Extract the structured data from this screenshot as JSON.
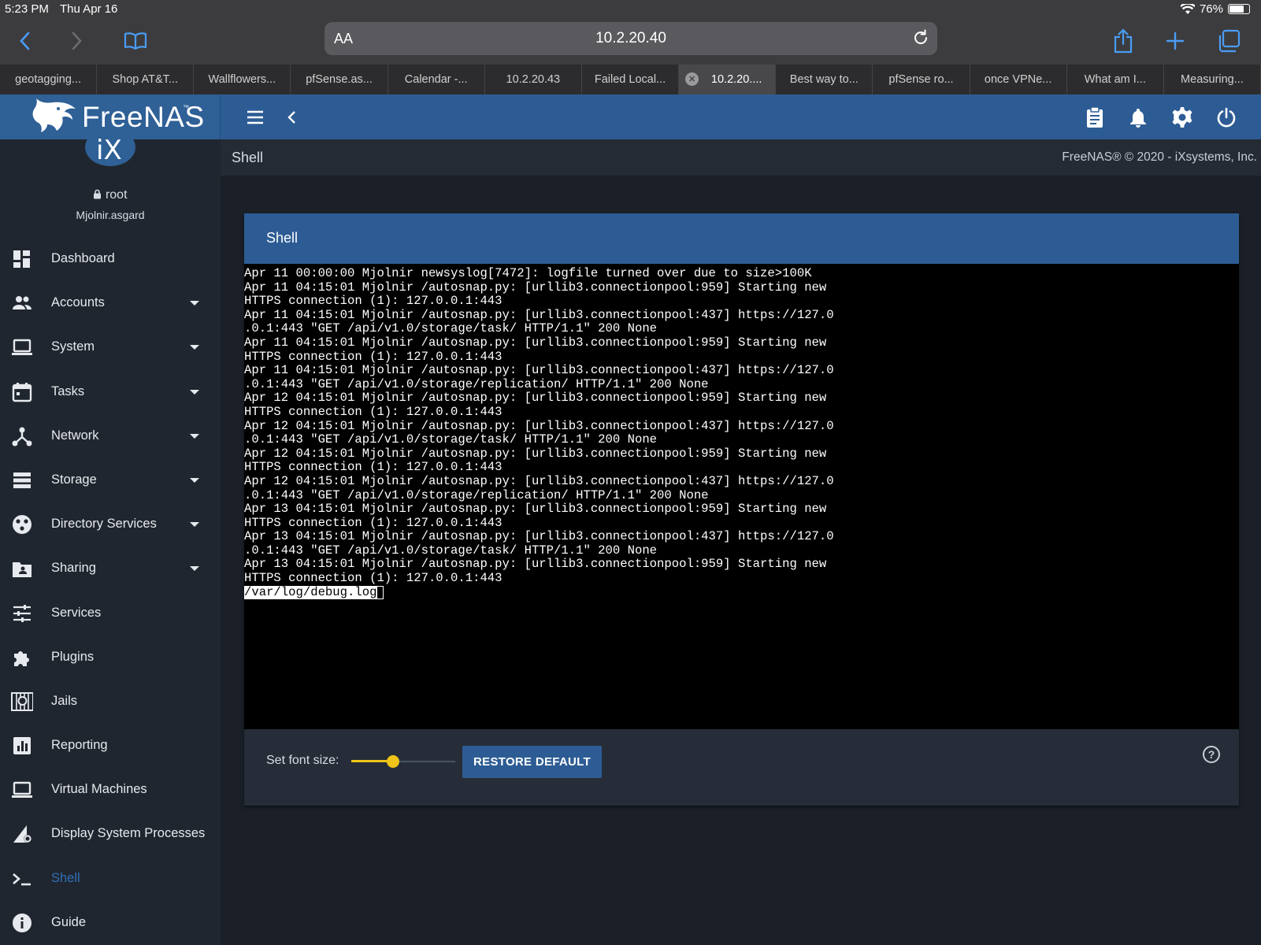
{
  "status_bar": {
    "time": "5:23 PM",
    "date": "Thu Apr 16",
    "battery": "76%",
    "battery_level": 0.76
  },
  "browser": {
    "text_size_label": "AA",
    "url": "10.2.20.40",
    "tabs": [
      {
        "label": "geotagging..."
      },
      {
        "label": "Shop AT&T..."
      },
      {
        "label": "Wallflowers..."
      },
      {
        "label": "pfSense.as..."
      },
      {
        "label": "Calendar -..."
      },
      {
        "label": "10.2.20.43"
      },
      {
        "label": "Failed Local..."
      },
      {
        "label": "10.2.20...."
      },
      {
        "label": "Best way to..."
      },
      {
        "label": "pfSense ro..."
      },
      {
        "label": "once VPNe..."
      },
      {
        "label": "What am I..."
      },
      {
        "label": "Measuring..."
      }
    ],
    "active_tab_index": 7
  },
  "header": {
    "brand": "FreeNAS",
    "brand_tm": "™",
    "accent_color": "#2d5c94"
  },
  "user": {
    "name": "root",
    "host": "Mjolnir.asgard",
    "logo_text": "iX"
  },
  "nav": [
    {
      "label": "Dashboard",
      "icon": "dashboard-icon",
      "has_caret": false
    },
    {
      "label": "Accounts",
      "icon": "accounts-icon",
      "has_caret": true
    },
    {
      "label": "System",
      "icon": "laptop-icon",
      "has_caret": true
    },
    {
      "label": "Tasks",
      "icon": "calendar-icon",
      "has_caret": true
    },
    {
      "label": "Network",
      "icon": "network-icon",
      "has_caret": true
    },
    {
      "label": "Storage",
      "icon": "storage-icon",
      "has_caret": true
    },
    {
      "label": "Directory Services",
      "icon": "directory-icon",
      "has_caret": true
    },
    {
      "label": "Sharing",
      "icon": "folder-share-icon",
      "has_caret": true
    },
    {
      "label": "Services",
      "icon": "tune-icon",
      "has_caret": false
    },
    {
      "label": "Plugins",
      "icon": "puzzle-icon",
      "has_caret": false
    },
    {
      "label": "Jails",
      "icon": "jail-icon",
      "has_caret": false
    },
    {
      "label": "Reporting",
      "icon": "chart-icon",
      "has_caret": false
    },
    {
      "label": "Virtual Machines",
      "icon": "monitor-icon",
      "has_caret": false
    },
    {
      "label": "Display System Processes",
      "icon": "processes-icon",
      "has_caret": false
    },
    {
      "label": "Shell",
      "icon": "terminal-icon",
      "has_caret": false,
      "active": true
    },
    {
      "label": "Guide",
      "icon": "info-icon",
      "has_caret": false
    }
  ],
  "page": {
    "breadcrumb": "Shell",
    "copyright": "FreeNAS® © 2020 - iXsystems, Inc."
  },
  "shell_card": {
    "title": "Shell",
    "terminal_lines": [
      "Apr 11 00:00:00 Mjolnir newsyslog[7472]: logfile turned over due to size>100K",
      "Apr 11 04:15:01 Mjolnir /autosnap.py: [urllib3.connectionpool:959] Starting new",
      "HTTPS connection (1): 127.0.0.1:443",
      "Apr 11 04:15:01 Mjolnir /autosnap.py: [urllib3.connectionpool:437] https://127.0",
      ".0.1:443 \"GET /api/v1.0/storage/task/ HTTP/1.1\" 200 None",
      "Apr 11 04:15:01 Mjolnir /autosnap.py: [urllib3.connectionpool:959] Starting new",
      "HTTPS connection (1): 127.0.0.1:443",
      "Apr 11 04:15:01 Mjolnir /autosnap.py: [urllib3.connectionpool:437] https://127.0",
      ".0.1:443 \"GET /api/v1.0/storage/replication/ HTTP/1.1\" 200 None",
      "Apr 12 04:15:01 Mjolnir /autosnap.py: [urllib3.connectionpool:959] Starting new",
      "HTTPS connection (1): 127.0.0.1:443",
      "Apr 12 04:15:01 Mjolnir /autosnap.py: [urllib3.connectionpool:437] https://127.0",
      ".0.1:443 \"GET /api/v1.0/storage/task/ HTTP/1.1\" 200 None",
      "Apr 12 04:15:01 Mjolnir /autosnap.py: [urllib3.connectionpool:959] Starting new",
      "HTTPS connection (1): 127.0.0.1:443",
      "Apr 12 04:15:01 Mjolnir /autosnap.py: [urllib3.connectionpool:437] https://127.0",
      ".0.1:443 \"GET /api/v1.0/storage/replication/ HTTP/1.1\" 200 None",
      "Apr 13 04:15:01 Mjolnir /autosnap.py: [urllib3.connectionpool:959] Starting new",
      "HTTPS connection (1): 127.0.0.1:443",
      "Apr 13 04:15:01 Mjolnir /autosnap.py: [urllib3.connectionpool:437] https://127.0",
      ".0.1:443 \"GET /api/v1.0/storage/task/ HTTP/1.1\" 200 None",
      "Apr 13 04:15:01 Mjolnir /autosnap.py: [urllib3.connectionpool:959] Starting new",
      "HTTPS connection (1): 127.0.0.1:443"
    ],
    "prompt_text": "/var/log/debug.log",
    "font_size_label": "Set font size:",
    "font_size_level": 0.4,
    "restore_label": "RESTORE DEFAULT"
  }
}
